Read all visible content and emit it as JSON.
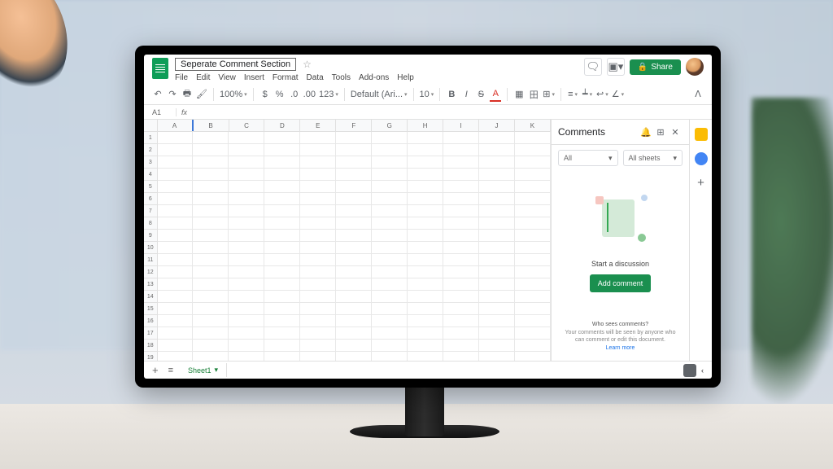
{
  "doc": {
    "title": "Seperate Comment Section",
    "star_glyph": "☆"
  },
  "menus": [
    "File",
    "Edit",
    "View",
    "Insert",
    "Format",
    "Data",
    "Tools",
    "Add-ons",
    "Help"
  ],
  "header_buttons": {
    "share": "Share",
    "lock_glyph": "🔒"
  },
  "toolbar": {
    "undo": "↶",
    "redo": "↷",
    "print": "🖶",
    "paint": "🖌",
    "zoom": "100%",
    "currency": "$",
    "percent": "%",
    "dec_dec": ".0",
    "dec_inc": ".00",
    "numfmt": "123",
    "font": "Default (Ari...",
    "size": "10",
    "bold": "B",
    "italic": "I",
    "strike": "S",
    "underline": "A",
    "fill": "▦",
    "borders": "田",
    "merge": "⊞",
    "halign": "≡",
    "valign": "┷",
    "wrap": "↩",
    "rotate": "∠",
    "collapse": "ᐱ"
  },
  "formula": {
    "cell_ref": "A1",
    "fx_glyph": "fx"
  },
  "columns": [
    "A",
    "B",
    "C",
    "D",
    "E",
    "F",
    "G",
    "H",
    "I",
    "J",
    "K"
  ],
  "row_count": 25,
  "comments": {
    "title": "Comments",
    "bell": "🔔",
    "new": "⊞",
    "close": "✕",
    "filter1": "All",
    "filter2": "All sheets",
    "discuss": "Start a discussion",
    "add_btn": "Add comment",
    "who": "Who sees comments?",
    "body": "Your comments will be seen by anyone who can comment or edit this document.",
    "learn": "Learn more"
  },
  "rail": {
    "plus": "+"
  },
  "tabs": {
    "plus": "+",
    "menu": "≡",
    "sheet": "Sheet1",
    "caret": "▾",
    "chevron": "‹"
  }
}
